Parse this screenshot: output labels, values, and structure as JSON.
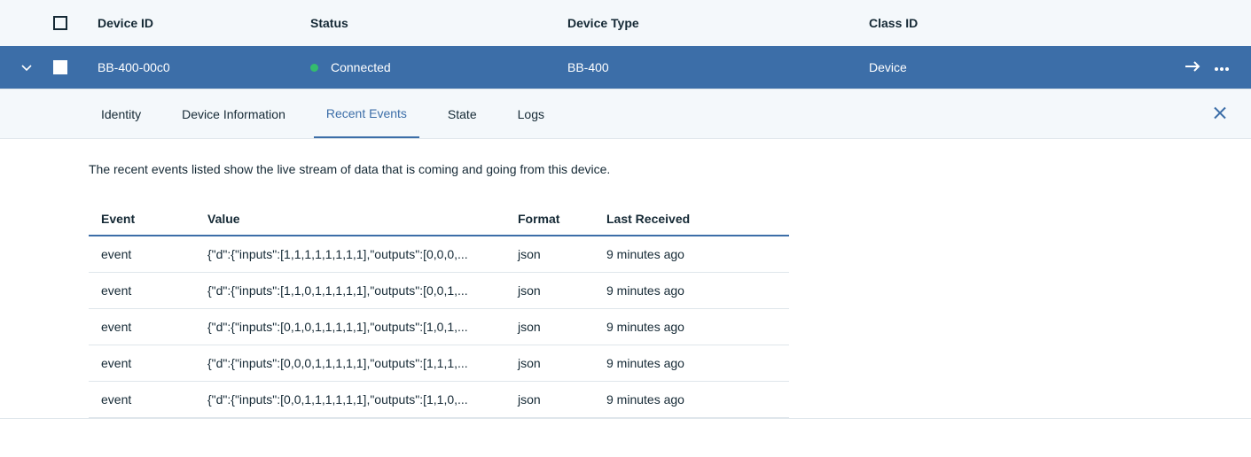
{
  "table": {
    "headers": {
      "device_id": "Device ID",
      "status": "Status",
      "device_type": "Device Type",
      "class_id": "Class ID"
    },
    "row": {
      "device_id": "BB-400-00c0",
      "status": "Connected",
      "device_type": "BB-400",
      "class_id": "Device"
    }
  },
  "tabs": {
    "identity": "Identity",
    "device_info": "Device Information",
    "recent_events": "Recent Events",
    "state": "State",
    "logs": "Logs"
  },
  "description": "The recent events listed show the live stream of data that is coming and going from this device.",
  "events": {
    "headers": {
      "event": "Event",
      "value": "Value",
      "format": "Format",
      "last_received": "Last Received"
    },
    "rows": [
      {
        "event": "event",
        "value": "{\"d\":{\"inputs\":[1,1,1,1,1,1,1,1],\"outputs\":[0,0,0,...",
        "format": "json",
        "last": "9 minutes ago"
      },
      {
        "event": "event",
        "value": "{\"d\":{\"inputs\":[1,1,0,1,1,1,1,1],\"outputs\":[0,0,1,...",
        "format": "json",
        "last": "9 minutes ago"
      },
      {
        "event": "event",
        "value": "{\"d\":{\"inputs\":[0,1,0,1,1,1,1,1],\"outputs\":[1,0,1,...",
        "format": "json",
        "last": "9 minutes ago"
      },
      {
        "event": "event",
        "value": "{\"d\":{\"inputs\":[0,0,0,1,1,1,1,1],\"outputs\":[1,1,1,...",
        "format": "json",
        "last": "9 minutes ago"
      },
      {
        "event": "event",
        "value": "{\"d\":{\"inputs\":[0,0,1,1,1,1,1,1],\"outputs\":[1,1,0,...",
        "format": "json",
        "last": "9 minutes ago"
      }
    ]
  }
}
